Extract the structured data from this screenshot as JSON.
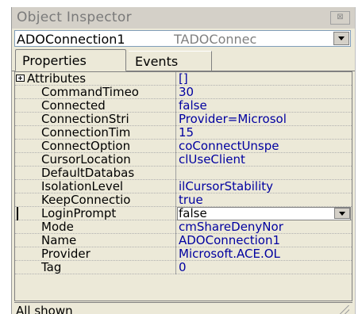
{
  "window": {
    "title": "Object Inspector",
    "close_glyph": "⊠"
  },
  "component_selector": {
    "name": "ADOConnection1",
    "type": "TADOConnec"
  },
  "tabs": [
    {
      "label": "Properties",
      "active": true
    },
    {
      "label": "Events",
      "active": false
    }
  ],
  "properties": [
    {
      "name": "Attributes",
      "value": "[]",
      "expandable": true
    },
    {
      "name": "CommandTimeo",
      "value": "30"
    },
    {
      "name": "Connected",
      "value": "false"
    },
    {
      "name": "ConnectionStri",
      "value": "Provider=Microsol"
    },
    {
      "name": "ConnectionTim",
      "value": "15"
    },
    {
      "name": "ConnectOption",
      "value": "coConnectUnspe"
    },
    {
      "name": "CursorLocation",
      "value": "clUseClient"
    },
    {
      "name": "DefaultDatabas",
      "value": ""
    },
    {
      "name": "IsolationLevel",
      "value": "ilCursorStability"
    },
    {
      "name": "KeepConnectio",
      "value": "true"
    },
    {
      "name": "LoginPrompt",
      "value": "false",
      "selected": true
    },
    {
      "name": "Mode",
      "value": "cmShareDenyNor"
    },
    {
      "name": "Name",
      "value": "ADOConnection1"
    },
    {
      "name": "Provider",
      "value": "Microsoft.ACE.OL"
    },
    {
      "name": "Tag",
      "value": "0"
    }
  ],
  "status": {
    "text": "All shown"
  },
  "colors": {
    "value_text": "#0000a0",
    "panel_bg": "#ece9d8"
  }
}
